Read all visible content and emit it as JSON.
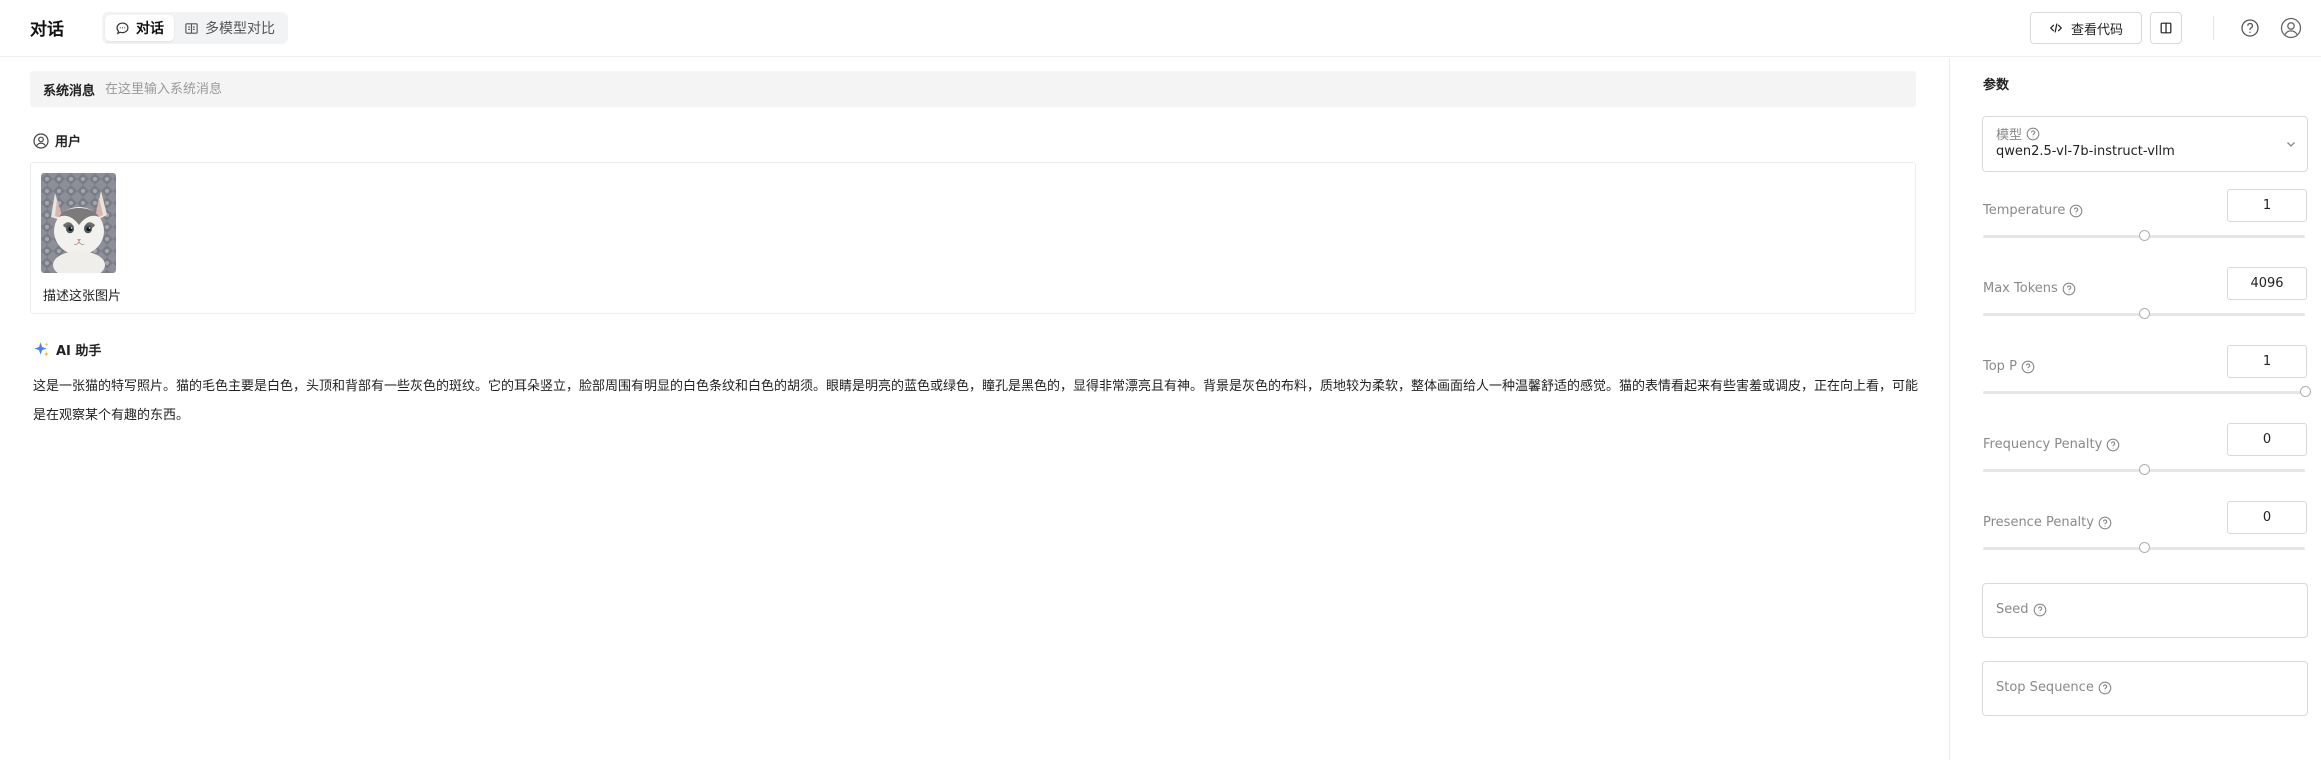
{
  "header": {
    "title": "对话",
    "tabs": [
      {
        "label": "对话",
        "icon": "chat-bubble-icon",
        "active": true
      },
      {
        "label": "多模型对比",
        "icon": "compare-icon",
        "active": false
      }
    ],
    "view_code_label": "查看代码"
  },
  "conversation": {
    "system": {
      "label": "系统消息",
      "placeholder": "在这里输入系统消息"
    },
    "user": {
      "role_label": "用户",
      "text": "描述这张图片"
    },
    "assistant": {
      "role_label": "AI 助手",
      "text": "这是一张猫的特写照片。猫的毛色主要是白色，头顶和背部有一些灰色的斑纹。它的耳朵竖立，脸部周围有明显的白色条纹和白色的胡须。眼睛是明亮的蓝色或绿色，瞳孔是黑色的，显得非常漂亮且有神。背景是灰色的布料，质地较为柔软，整体画面给人一种温馨舒适的感觉。猫的表情看起来有些害羞或调皮，正在向上看，可能是在观察某个有趣的东西。"
    }
  },
  "panel": {
    "title": "参数",
    "model": {
      "label": "模型",
      "value": "qwen2.5-vl-7b-instruct-vllm"
    },
    "params": [
      {
        "label": "Temperature",
        "value": "1",
        "slider_fraction": 0.5
      },
      {
        "label": "Max Tokens",
        "value": "4096",
        "slider_fraction": 0.5
      },
      {
        "label": "Top P",
        "value": "1",
        "slider_fraction": 1.0
      },
      {
        "label": "Frequency Penalty",
        "value": "0",
        "slider_fraction": 0.5
      },
      {
        "label": "Presence Penalty",
        "value": "0",
        "slider_fraction": 0.5
      }
    ],
    "seed_label": "Seed",
    "stop_sequence_label": "Stop Sequence"
  }
}
